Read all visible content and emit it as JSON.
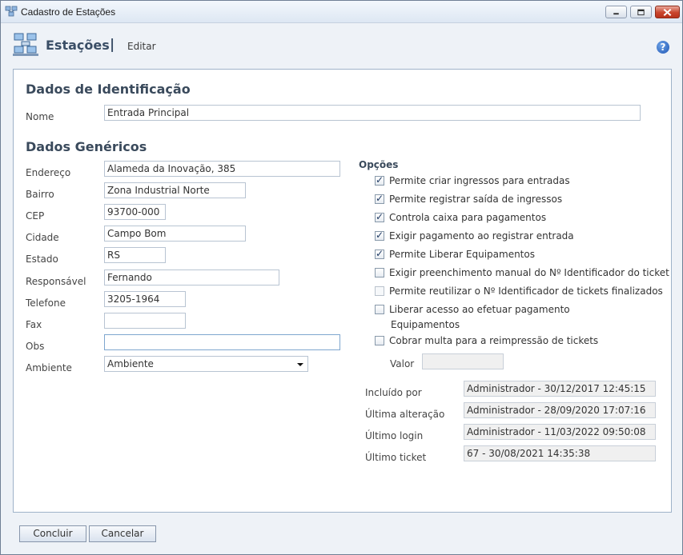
{
  "window": {
    "title": "Cadastro de Estações",
    "controls": [
      "minimize-icon",
      "maximize-icon",
      "close-icon"
    ]
  },
  "header": {
    "title": "Estações",
    "separator": "|",
    "action": "Editar",
    "help_glyph": "?"
  },
  "identificacao": {
    "heading": "Dados de Identificação",
    "nome_label": "Nome",
    "nome_value": "Entrada Principal"
  },
  "genericos": {
    "heading": "Dados Genéricos",
    "fields": [
      {
        "label": "Endereço",
        "value": "Alameda da Inovação, 385"
      },
      {
        "label": "Bairro",
        "value": "Zona Industrial Norte"
      },
      {
        "label": "CEP",
        "value": "93700-000"
      },
      {
        "label": "Cidade",
        "value": "Campo Bom"
      },
      {
        "label": "Estado",
        "value": "RS"
      },
      {
        "label": "Responsável",
        "value": "Fernando"
      },
      {
        "label": "Telefone",
        "value": "3205-1964"
      },
      {
        "label": "Fax",
        "value": ""
      },
      {
        "label": "Obs",
        "value": ""
      }
    ],
    "ambiente_label": "Ambiente",
    "ambiente_value": "Ambiente"
  },
  "opcoes": {
    "heading": "Opções",
    "items": [
      {
        "label": "Permite criar ingressos para entradas",
        "checked": true
      },
      {
        "label": "Permite registrar saída de ingressos",
        "checked": true
      },
      {
        "label": "Controla caixa para pagamentos",
        "checked": true
      },
      {
        "label": "Exigir pagamento ao registrar entrada",
        "checked": true
      },
      {
        "label": "Permite Liberar Equipamentos",
        "checked": true
      },
      {
        "label": "Exigir preenchimento manual do Nº Identificador do ticket",
        "checked": false
      },
      {
        "label": "Permite reutilizar o Nº Identificador de tickets finalizados",
        "checked": false,
        "disabled": true
      },
      {
        "label": "Liberar acesso ao efetuar pagamento",
        "label2": "Equipamentos",
        "checked": false
      },
      {
        "label": "Cobrar multa para a reimpressão de tickets",
        "checked": false
      }
    ],
    "valor_label": "Valor",
    "valor_value": ""
  },
  "audit": [
    {
      "label": "Incluído por",
      "value": "Administrador - 30/12/2017 12:45:15"
    },
    {
      "label": "Última alteração",
      "value": "Administrador - 28/09/2020 17:07:16"
    },
    {
      "label": "Último login",
      "value": "Administrador - 11/03/2022 09:50:08"
    },
    {
      "label": "Último ticket",
      "value": "67 - 30/08/2021 14:35:38"
    }
  ],
  "buttons": {
    "concluir": "Concluir",
    "cancelar": "Cancelar"
  }
}
